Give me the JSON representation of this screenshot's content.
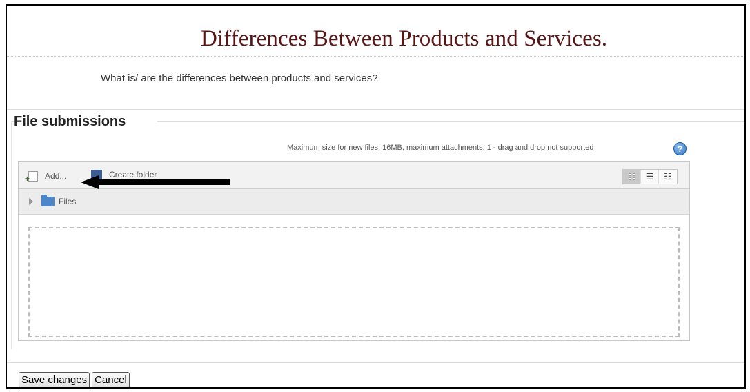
{
  "page": {
    "heading": "Differences Between Products and Services.",
    "question": "What is/ are the differences between products and services?"
  },
  "file_submissions": {
    "legend": "File submissions",
    "max_size_note": "Maximum size for new files: 16MB, maximum attachments: 1 - drag and drop not supported",
    "help_icon_glyph": "?",
    "toolbar": {
      "add_label": "Add...",
      "create_folder_label": "Create folder"
    },
    "view_modes": [
      "icons",
      "list",
      "tree"
    ],
    "active_view": "icons",
    "path_label": "Files"
  },
  "actions": {
    "save_label": "Save changes",
    "cancel_label": "Cancel"
  },
  "colors": {
    "heading": "#5a1414",
    "help_icon": "#2f73c4"
  },
  "icons": {
    "add": "add-file-icon",
    "create_folder": "create-folder-icon",
    "help": "help-icon",
    "path_folder": "folder-icon",
    "arrow": "arrow-left-icon"
  }
}
